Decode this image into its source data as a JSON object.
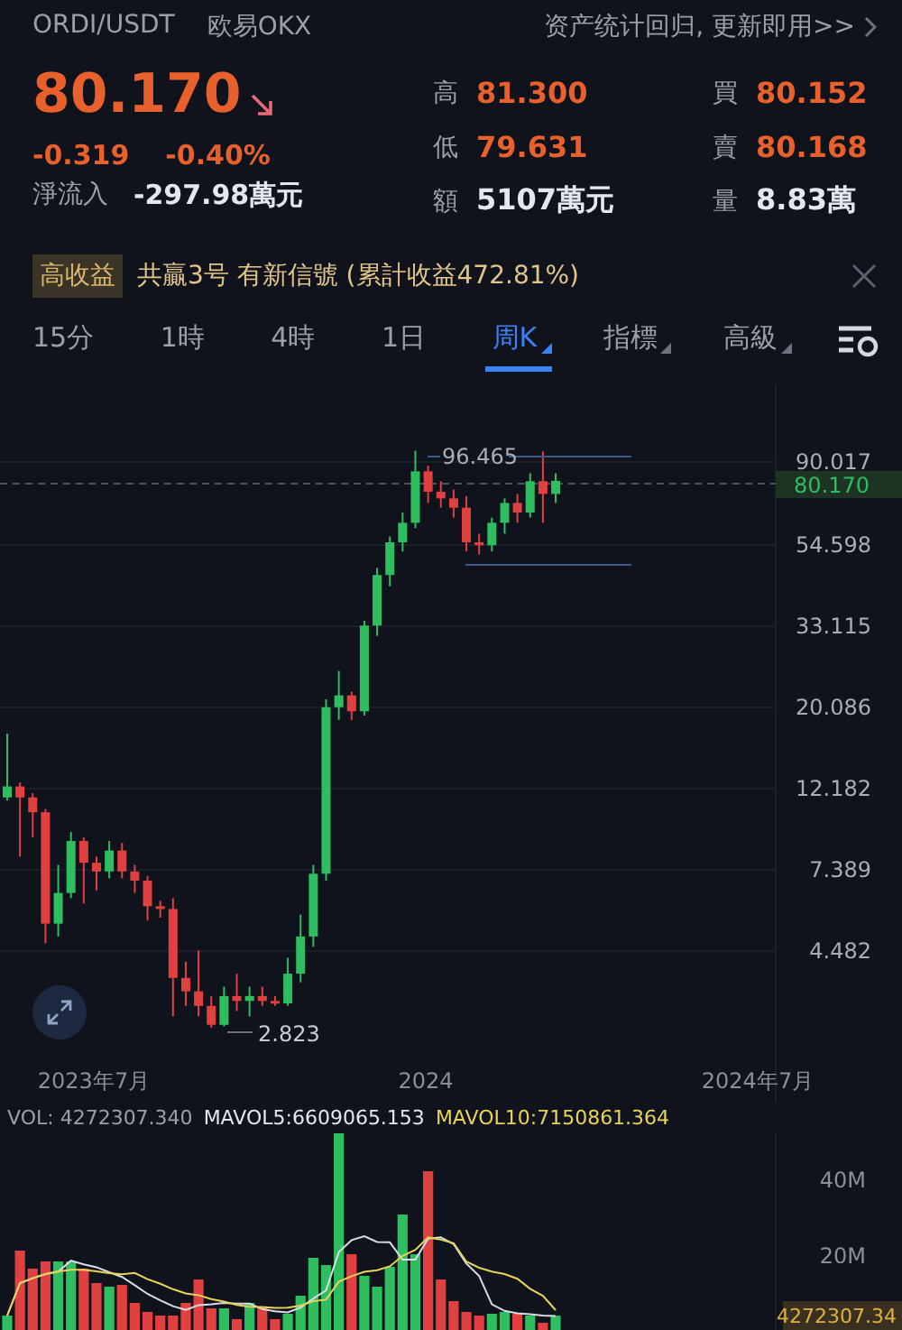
{
  "header": {
    "pair": "ORDI/USDT",
    "exchange": "欧易OKX",
    "notice": "资产统计回归, 更新即用>>"
  },
  "quote": {
    "price": "80.170",
    "change": "-0.319",
    "change_pct": "-0.40%",
    "inflow_label": "淨流入",
    "inflow": "-297.98萬元"
  },
  "stats": [
    {
      "label": "高",
      "value": "81.300",
      "color": "#e8602c"
    },
    {
      "label": "買",
      "value": "80.152",
      "color": "#e8602c"
    },
    {
      "label": "低",
      "value": "79.631",
      "color": "#e8602c"
    },
    {
      "label": "賣",
      "value": "80.168",
      "color": "#e8602c"
    },
    {
      "label": "額",
      "value": "5107萬元",
      "color": "#e4e7ee"
    },
    {
      "label": "量",
      "value": "8.83萬",
      "color": "#e4e7ee"
    }
  ],
  "banner": {
    "badge": "高收益",
    "text": "共贏3号 有新信號 (累計收益472.81%)"
  },
  "timeframes": [
    {
      "label": "15分",
      "selected": false,
      "dropdown": false
    },
    {
      "label": "1時",
      "selected": false,
      "dropdown": false
    },
    {
      "label": "4時",
      "selected": false,
      "dropdown": false
    },
    {
      "label": "1日",
      "selected": false,
      "dropdown": false
    },
    {
      "label": "周K",
      "selected": true,
      "dropdown": true
    },
    {
      "label": "指標",
      "selected": false,
      "dropdown": true
    },
    {
      "label": "高級",
      "selected": false,
      "dropdown": true
    }
  ],
  "chart": {
    "price_labels": [
      "90.017",
      "54.598",
      "33.115",
      "20.086",
      "12.182",
      "7.389",
      "4.482"
    ],
    "current_price": "80.170",
    "high_marker": "96.465",
    "low_marker": "2.823",
    "date_labels": [
      "2023年7月",
      "2024",
      "2024年7月"
    ]
  },
  "volume": {
    "vol": "VOL: 4272307.340",
    "mavol5": "MAVOL5:6609065.153",
    "mavol10": "MAVOL10:7150861.364",
    "axis_labels": [
      "40M",
      "20M"
    ],
    "current": "4272307.34"
  }
}
